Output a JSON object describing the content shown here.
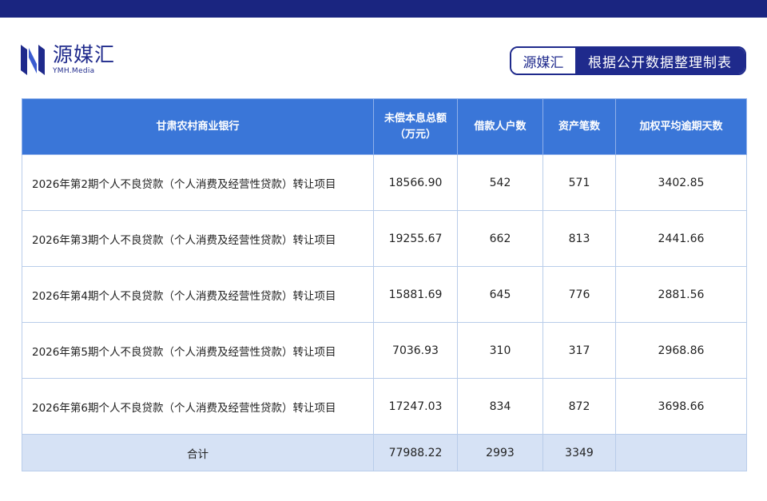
{
  "header": {
    "logo_name": "源媒汇",
    "logo_sub": "YMH.Media",
    "source_brand": "源媒汇",
    "source_desc": "根据公开数据整理制表"
  },
  "colors": {
    "top_bar": "#1a2580",
    "brand": "#1f2a8c",
    "header_bg": "#3a76d8",
    "total_row_bg": "#d6e2f5"
  },
  "table": {
    "columns": [
      "甘肃农村商业银行",
      "未偿本息总额（万元）",
      "借款人户数",
      "资产笔数",
      "加权平均逾期天数"
    ],
    "rows": [
      [
        "2026年第2期个人不良贷款（个人消费及经营性贷款）转让项目",
        "18566.90",
        "542",
        "571",
        "3402.85"
      ],
      [
        "2026年第3期个人不良贷款（个人消费及经营性贷款）转让项目",
        "19255.67",
        "662",
        "813",
        "2441.66"
      ],
      [
        "2026年第4期个人不良贷款（个人消费及经营性贷款）转让项目",
        "15881.69",
        "645",
        "776",
        "2881.56"
      ],
      [
        "2026年第5期个人不良贷款（个人消费及经营性贷款）转让项目",
        "7036.93",
        "310",
        "317",
        "2968.86"
      ],
      [
        "2026年第6期个人不良贷款（个人消费及经营性贷款）转让项目",
        "17247.03",
        "834",
        "872",
        "3698.66"
      ]
    ],
    "total": [
      "合计",
      "77988.22",
      "2993",
      "3349",
      ""
    ]
  }
}
